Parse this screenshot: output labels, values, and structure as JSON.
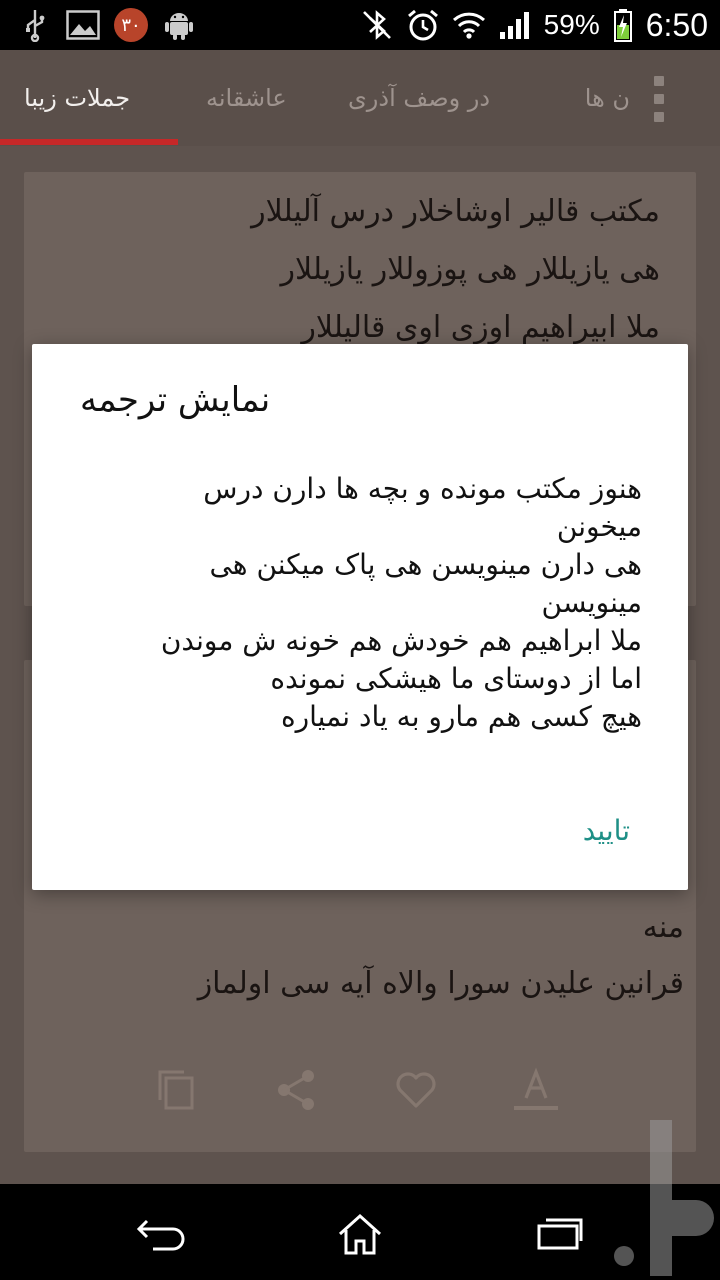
{
  "status_bar": {
    "notification_badge": "۳۰",
    "battery_percent": "59%",
    "time": "6:50",
    "icons": [
      "usb-icon",
      "image-icon",
      "android-icon",
      "bluetooth-off-icon",
      "alarm-icon",
      "wifi-icon",
      "signal-icon",
      "battery-charging-icon"
    ]
  },
  "tabs": [
    {
      "label": "جملات زیبا",
      "active": true
    },
    {
      "label": "عاشقانه",
      "active": false
    },
    {
      "label": "در وصف آذری",
      "active": false
    },
    {
      "label": "ن ها",
      "active": false
    }
  ],
  "card1": {
    "lines": [
      "مکتب قالیر اوشاخلار درس آلیللار",
      "هی یازیللار هی پوزوللار یازیللار",
      "ملا ابیراهیم اوزی اوی قالیللار"
    ]
  },
  "card2": {
    "lines": [
      "منه",
      "قرانین علیدن سورا والاه آیه سی اولماز"
    ],
    "actions": [
      "copy-icon",
      "share-icon",
      "heart-icon",
      "text-format-icon"
    ]
  },
  "dialog": {
    "title": "نمایش ترجمه",
    "lines": [
      "هنوز مکتب مونده و بچه ها دارن درس میخونن",
      "هی دارن مینویسن هی پاک میکنن هی مینویسن",
      "ملا ابراهیم هم خودش هم خونه ش موندن",
      "اما از دوستای ما هیشکی نمونده",
      "هیچ کسی هم مارو به یاد نمیاره"
    ],
    "confirm_label": "تایید"
  },
  "colors": {
    "accent": "#c62828",
    "dialog_button": "#1e8f86",
    "tab_bar": "#5a4f4a",
    "card": "#6e625c"
  }
}
